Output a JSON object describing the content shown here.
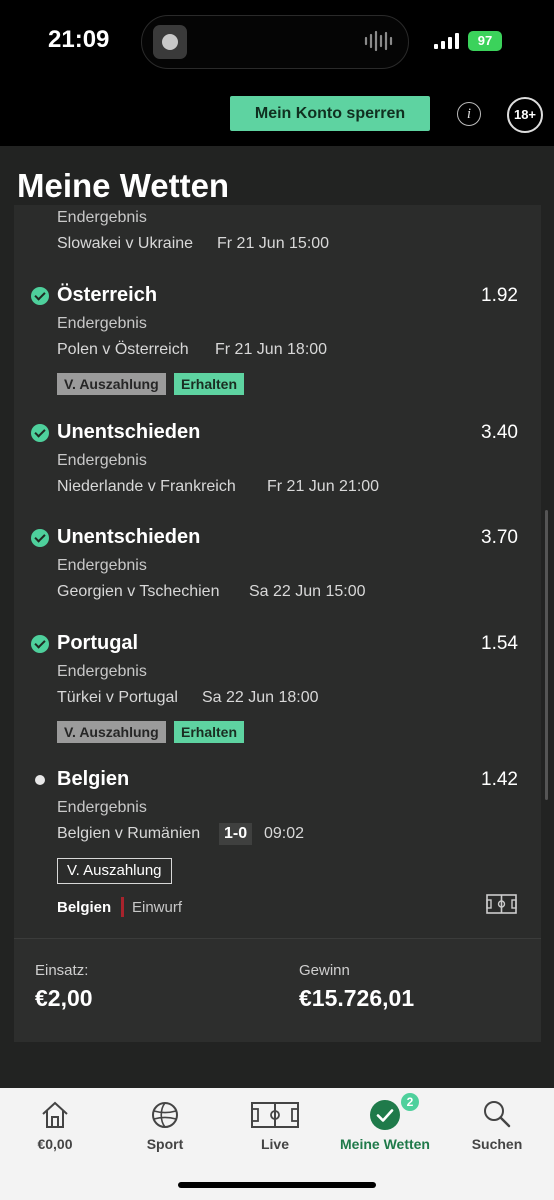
{
  "status": {
    "time": "21:09",
    "battery": "97"
  },
  "header": {
    "lock_button": "Mein Konto sperren",
    "info_icon": "i",
    "age_badge": "18+"
  },
  "page": {
    "title": "Meine Wetten"
  },
  "bets": [
    {
      "market": "Endergebnis",
      "teams": "Slowakei v Ukraine",
      "datetime": "Fr 21 Jun 15:00"
    },
    {
      "selection": "Österreich",
      "odds": "1.92",
      "market": "Endergebnis",
      "teams": "Polen v Österreich",
      "datetime": "Fr 21 Jun 18:00",
      "payout_tag": "V. Auszahlung",
      "status_tag": "Erhalten"
    },
    {
      "selection": "Unentschieden",
      "odds": "3.40",
      "market": "Endergebnis",
      "teams": "Niederlande v Frankreich",
      "datetime": "Fr 21 Jun 21:00"
    },
    {
      "selection": "Unentschieden",
      "odds": "3.70",
      "market": "Endergebnis",
      "teams": "Georgien v Tschechien",
      "datetime": "Sa 22 Jun 15:00"
    },
    {
      "selection": "Portugal",
      "odds": "1.54",
      "market": "Endergebnis",
      "teams": "Türkei v Portugal",
      "datetime": "Sa 22 Jun 18:00",
      "payout_tag": "V. Auszahlung",
      "status_tag": "Erhalten"
    },
    {
      "selection": "Belgien",
      "odds": "1.42",
      "market": "Endergebnis",
      "teams": "Belgien v Rumänien",
      "score": "1-0",
      "time": "09:02",
      "payout_button": "V. Auszahlung",
      "live_team": "Belgien",
      "live_event": "Einwurf"
    }
  ],
  "summary": {
    "stake_label": "Einsatz:",
    "stake_value": "€2,00",
    "win_label": "Gewinn",
    "win_value": "€15.726,01"
  },
  "nav": [
    {
      "label": "€0,00",
      "icon": "home-icon"
    },
    {
      "label": "Sport",
      "icon": "football-icon"
    },
    {
      "label": "Live",
      "icon": "pitch-icon"
    },
    {
      "label": "Meine Wetten",
      "icon": "check-circle-icon",
      "badge": "2",
      "active": true
    },
    {
      "label": "Suchen",
      "icon": "search-icon"
    }
  ],
  "colors": {
    "accent": "#5ed3a1",
    "background": "#222322",
    "card": "#2b2c2b",
    "live_marker": "#a8232c"
  }
}
